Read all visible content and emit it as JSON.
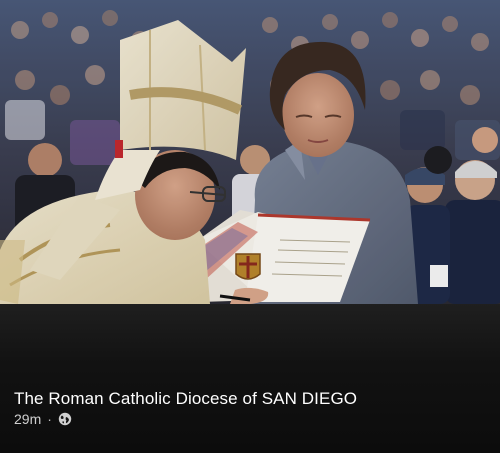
{
  "post": {
    "photo_alt_icon": "photo",
    "page_name": "The Roman Catholic Diocese of SAN DIEGO",
    "timestamp": "29m",
    "separator": "·",
    "audience_icon": "globe-icon"
  }
}
